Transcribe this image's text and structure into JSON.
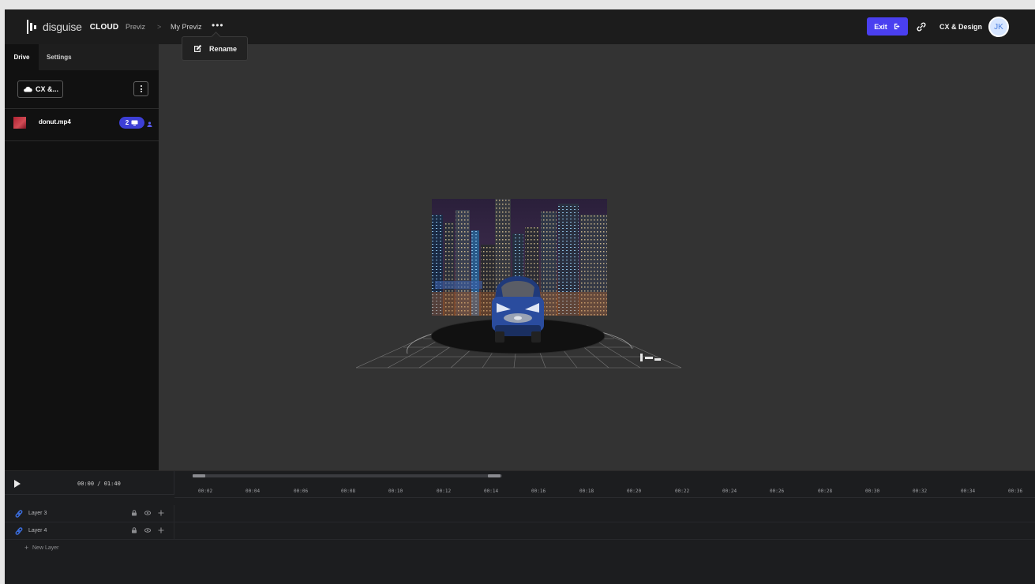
{
  "header": {
    "logo_text": "disguise",
    "logo_cloud": "CLOUD",
    "breadcrumb": [
      "Previz",
      "My Previz"
    ],
    "breadcrumb_separator": ">",
    "more_label": "•••",
    "exit_label": "Exit",
    "user_name": "CX & Design",
    "avatar_initials": "JK"
  },
  "rename_menu": {
    "label": "Rename",
    "icon": "edit-icon"
  },
  "sidebar": {
    "tabs": [
      {
        "label": "Drive",
        "active": true
      },
      {
        "label": "Settings",
        "active": false
      }
    ],
    "storage_button": {
      "label": "CX &...",
      "icon": "cloud-icon"
    },
    "files": [
      {
        "name": "donut.mp4",
        "badge_count": "2",
        "badge_icon": "screen-icon",
        "user_icon": "person-icon"
      }
    ]
  },
  "viewport": {
    "scene": "city-backdrop-with-car-on-turntable"
  },
  "timeline": {
    "timecode": "00:00 / 01:40",
    "ticks": [
      "00:02",
      "00:04",
      "00:06",
      "00:08",
      "00:10",
      "00:12",
      "00:14",
      "00:16",
      "00:18",
      "00:20",
      "00:22",
      "00:24",
      "00:26",
      "00:28",
      "00:30",
      "00:32",
      "00:34",
      "00:36"
    ],
    "layers": [
      {
        "name": "Layer 3",
        "icon": "layer-link-icon"
      },
      {
        "name": "Layer 4",
        "icon": "layer-link-icon"
      }
    ],
    "new_layer_label": "New Layer",
    "new_layer_icon": "+"
  },
  "colors": {
    "accent": "#4a3ff0",
    "badge": "#3d3fd6",
    "topbar": "#1c1c1c",
    "viewport_bg": "#333333",
    "sidebar_bg": "#111111"
  }
}
